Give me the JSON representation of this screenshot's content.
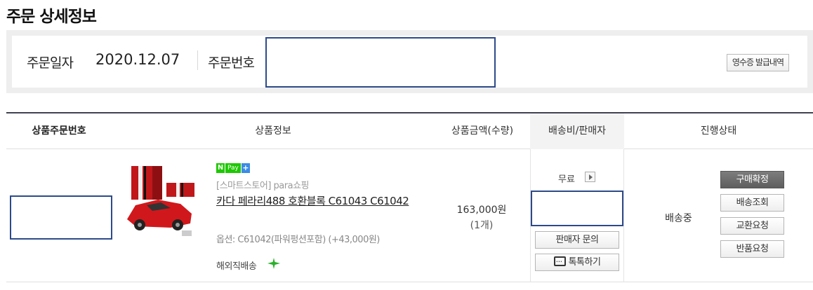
{
  "page": {
    "title": "주문 상세정보"
  },
  "summary": {
    "order_date_label": "주문일자",
    "order_date": "2020.12.07",
    "order_no_label": "주문번호",
    "receipt_button": "영수증 발급내역"
  },
  "table": {
    "headers": [
      "상품주문번호",
      "상품정보",
      "상품금액(수량)",
      "배송비/판매자",
      "진행상태"
    ]
  },
  "item": {
    "pay_badge": {
      "n": "N",
      "pay": "Pay",
      "plus": "+"
    },
    "store": "[스마트스토어] para쇼핑",
    "name": "카다 페라리488 호환블록 C61043 C61042",
    "option": "옵션: C61042(파워펑션포함) (+43,000원)",
    "overseas": "해외직배송",
    "price": "163,000원",
    "qty": "(1개)",
    "shipping_fee": "무료",
    "seller_inquiry_button": "판매자 문의",
    "talk_button": "톡톡하기",
    "status": "배송중",
    "actions": [
      "구매확정",
      "배송조회",
      "교환요청",
      "반품요청"
    ]
  },
  "colors": {
    "npay_green": "#1ec800",
    "redaction_border": "#2d4a8a",
    "header_rule": "#3f4250"
  }
}
